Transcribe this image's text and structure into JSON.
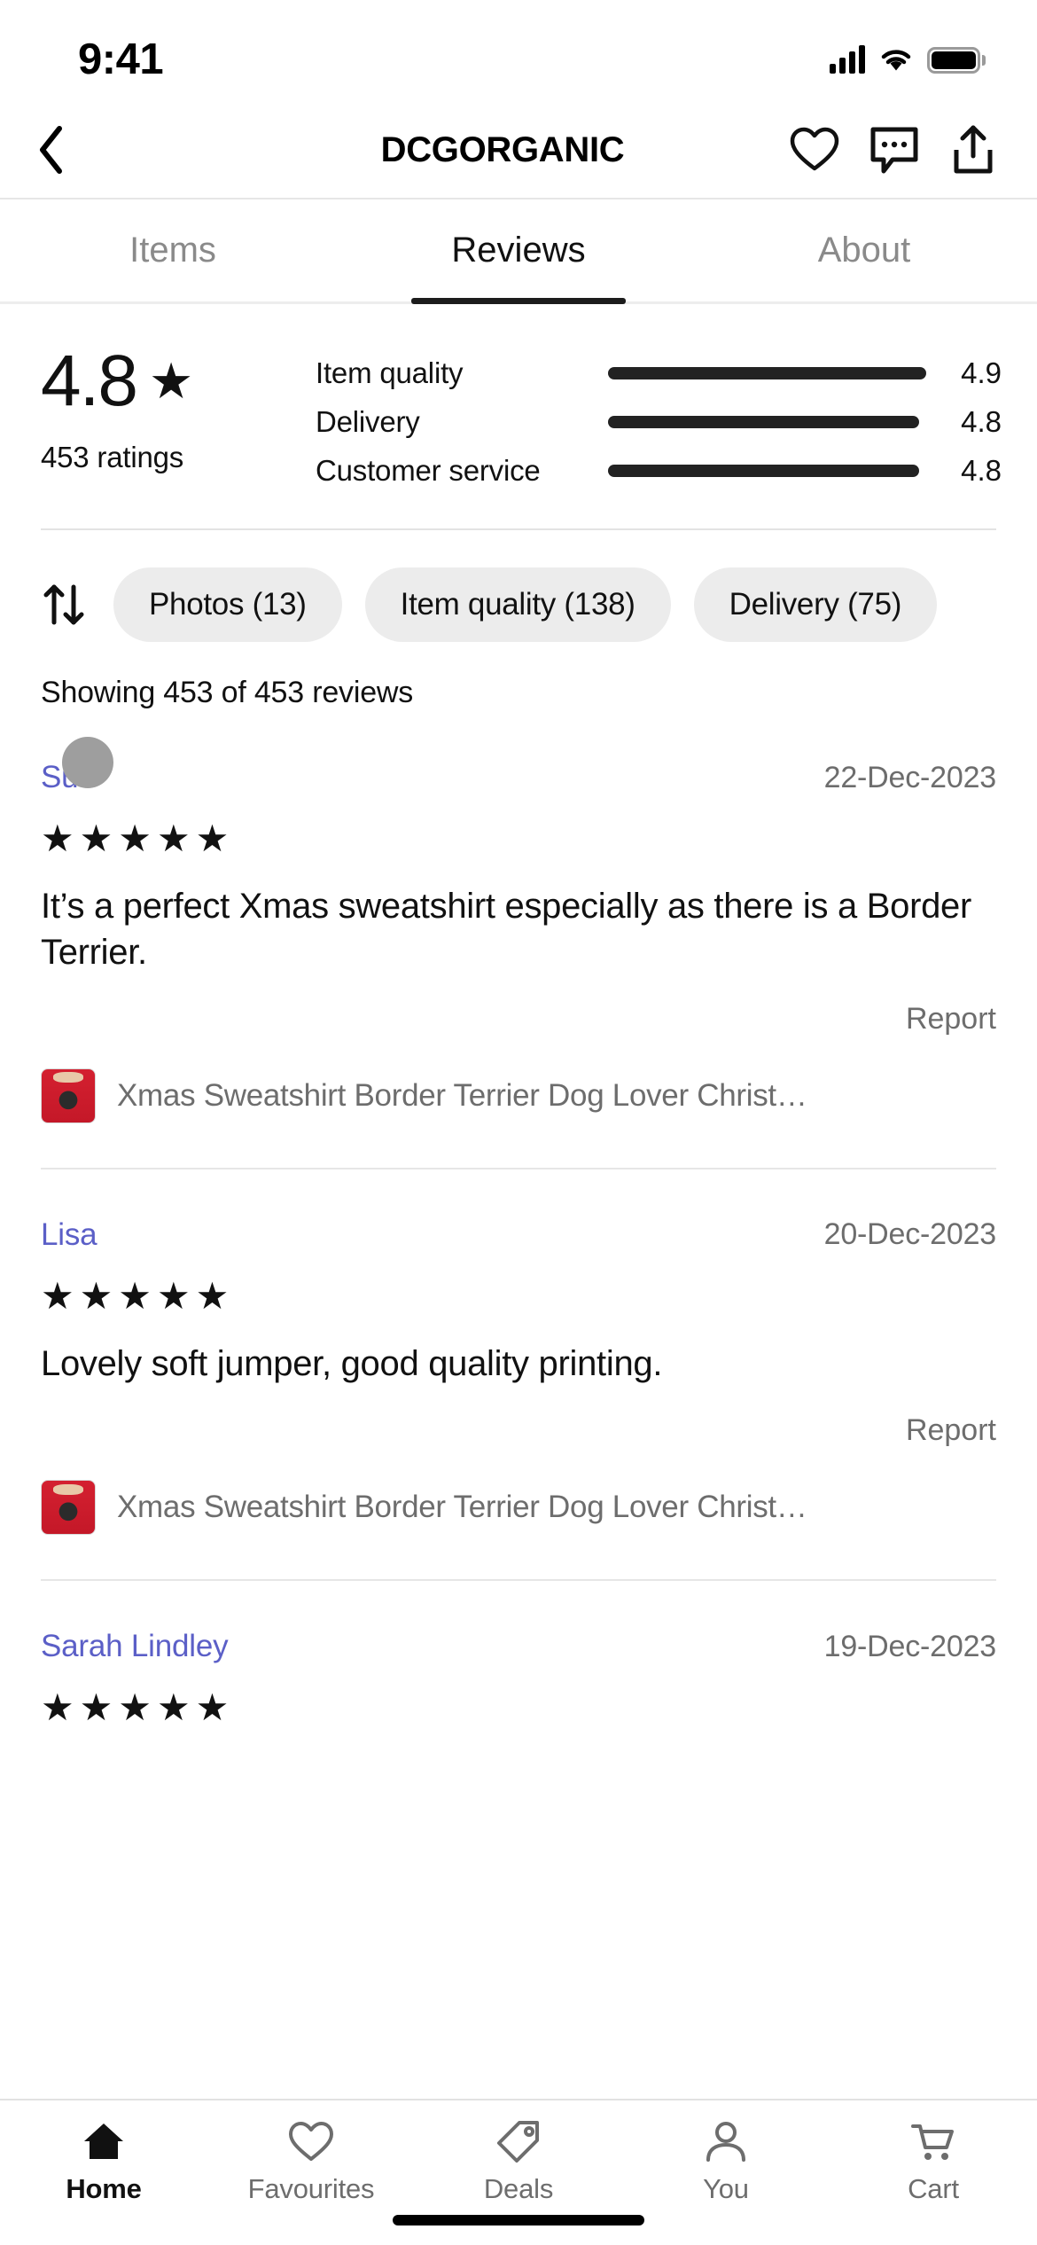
{
  "status_bar": {
    "time": "9:41",
    "signal_icon": "cellular-signal-icon",
    "wifi_icon": "wifi-icon",
    "battery_icon": "battery-icon"
  },
  "header": {
    "back_icon": "chevron-left-icon",
    "title": "DCGORGANIC",
    "favourite_icon": "heart-icon",
    "message_icon": "message-icon",
    "share_icon": "share-icon"
  },
  "tabs": [
    {
      "label": "Items",
      "active": false
    },
    {
      "label": "Reviews",
      "active": true
    },
    {
      "label": "About",
      "active": false
    }
  ],
  "rating_summary": {
    "score": "4.8",
    "star_glyph": "★",
    "ratings_count": "453 ratings",
    "breakdown": [
      {
        "label": "Item quality",
        "value": "4.9",
        "bar_percent": 98
      },
      {
        "label": "Delivery",
        "value": "4.8",
        "bar_percent": 96
      },
      {
        "label": "Customer service",
        "value": "4.8",
        "bar_percent": 96
      }
    ]
  },
  "filters": {
    "sort_icon": "sort-arrows-icon",
    "chips": [
      {
        "label": "Photos (13)"
      },
      {
        "label": "Item quality (138)"
      },
      {
        "label": "Delivery (75)"
      }
    ]
  },
  "showing_text": "Showing 453 of 453 reviews",
  "reviews": [
    {
      "reviewer": "Sue",
      "date": "22-Dec-2023",
      "stars": "★★★★★",
      "text": "It’s a perfect Xmas sweatshirt especially as there is a Border Terrier.",
      "report_label": "Report",
      "product_title": "Xmas Sweatshirt Border Terrier Dog Lover Christ…",
      "product_thumb": "red-sweatshirt-thumbnail"
    },
    {
      "reviewer": "Lisa",
      "date": "20-Dec-2023",
      "stars": "★★★★★",
      "text": "Lovely soft jumper, good quality printing.",
      "report_label": "Report",
      "product_title": "Xmas Sweatshirt Border Terrier Dog Lover Christ…",
      "product_thumb": "red-sweatshirt-thumbnail"
    },
    {
      "reviewer": "Sarah Lindley",
      "date": "19-Dec-2023",
      "stars": "★★★★★",
      "text": "",
      "report_label": "",
      "product_title": "",
      "product_thumb": ""
    }
  ],
  "bottom_nav": [
    {
      "label": "Home",
      "icon": "home-icon",
      "active": true
    },
    {
      "label": "Favourites",
      "icon": "heart-icon",
      "active": false
    },
    {
      "label": "Deals",
      "icon": "tag-icon",
      "active": false
    },
    {
      "label": "You",
      "icon": "person-icon",
      "active": false
    },
    {
      "label": "Cart",
      "icon": "cart-icon",
      "active": false
    }
  ],
  "colors": {
    "accent_link": "#5b5fc7",
    "text_primary": "#111111",
    "text_muted": "#6d6d6d",
    "chip_bg": "#ececec"
  }
}
